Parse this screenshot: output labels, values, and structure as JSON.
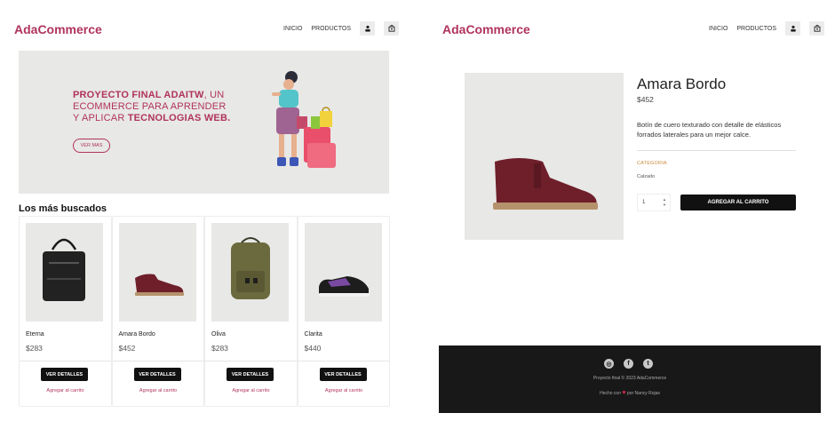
{
  "brand": "AdaCommerce",
  "nav": {
    "home": "INICIO",
    "products": "PRODUCTOS"
  },
  "hero": {
    "line_bold_1": "PROYECTO FINAL ADAITW",
    "line_rest_1": ", UN ECOMMERCE PARA APRENDER Y APLICAR ",
    "line_bold_2": "TECNOLOGIAS WEB.",
    "cta": "VER MAS"
  },
  "section_title": "Los más buscados",
  "products": [
    {
      "name": "Eterna",
      "price": "$283",
      "details": "VER DETALLES",
      "add": "Agregar al carrito"
    },
    {
      "name": "Amara Bordo",
      "price": "$452",
      "details": "VER DETALLES",
      "add": "Agregar al carrito"
    },
    {
      "name": "Oliva",
      "price": "$283",
      "details": "VER DETALLES",
      "add": "Agregar al carrito"
    },
    {
      "name": "Clarita",
      "price": "$440",
      "details": "VER DETALLES",
      "add": "Agregar al carrito"
    }
  ],
  "detail": {
    "title": "Amara Bordo",
    "price": "$452",
    "description": "Botín de cuero texturado con detalle de elásticos forrados laterales para un mejor calce.",
    "category_label": "CATEGORIA",
    "category_value": "Calzado",
    "quantity": "1",
    "add_button": "AGREGAR AL CARRITO"
  },
  "footer": {
    "line1": "Proyecto final © 2023 AdaCommerce",
    "line2_a": "Hecho con",
    "line2_b": "por Nancy Rojas"
  },
  "colors": {
    "brand": "#b0335e",
    "dark": "#111111",
    "footer_bg": "#181818",
    "placeholder": "#e8e8e6"
  }
}
